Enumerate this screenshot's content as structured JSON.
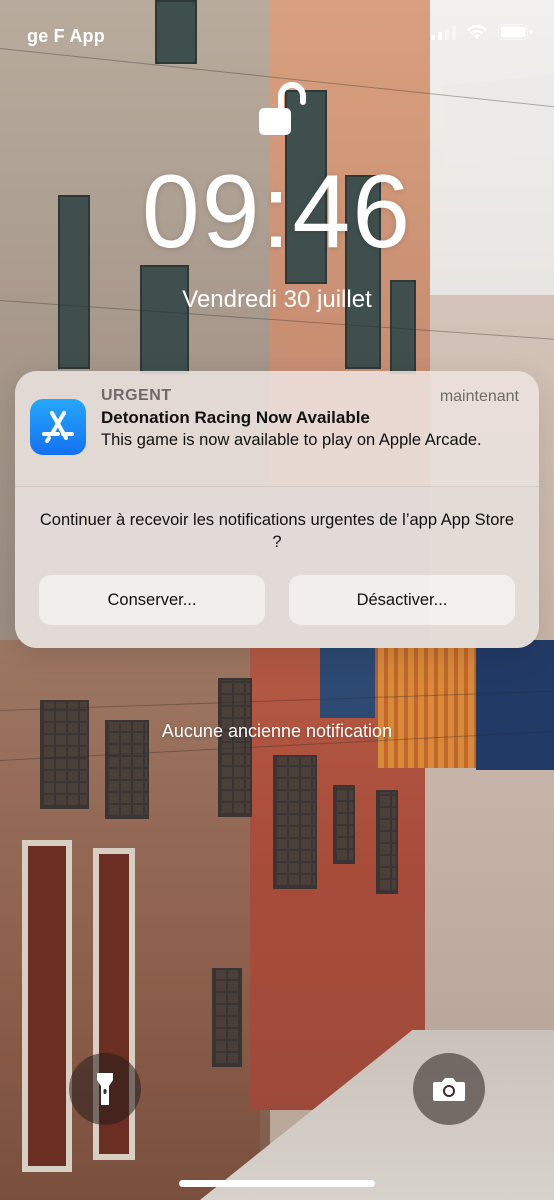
{
  "status_bar": {
    "carrier": "ge F App",
    "icons": [
      "cellular-signal-icon",
      "wifi-icon",
      "battery-icon"
    ]
  },
  "lock_screen": {
    "lock_icon": "unlocked-padlock-icon",
    "time": "09:46",
    "date": "Vendredi 30 juillet"
  },
  "notification": {
    "app_icon": "app-store-icon",
    "label": "URGENT",
    "timestamp": "maintenant",
    "title": "Detonation Racing Now Available",
    "body": "This game is now available to play on Apple Arcade.",
    "prompt": "Continuer à recevoir les notifications urgentes de l’app App Store ?",
    "keep_button": "Conserver...",
    "disable_button": "Désactiver..."
  },
  "no_older_notifications": "Aucune ancienne notification",
  "bottom_controls": {
    "flashlight_icon": "flashlight-icon",
    "camera_icon": "camera-icon"
  },
  "colors": {
    "app_icon_top": "#27a7fb",
    "app_icon_bottom": "#1471f2",
    "notification_bg": "#ece2de"
  }
}
